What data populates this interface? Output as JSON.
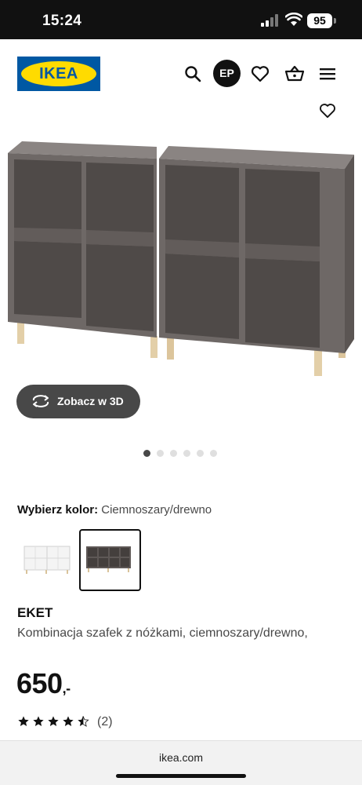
{
  "status_bar": {
    "time": "15:24",
    "battery": "95"
  },
  "header": {
    "logo_text": "IKEA",
    "account_initials": "EP"
  },
  "gallery": {
    "view_3d_label": "Zobacz w 3D",
    "dot_count": 6,
    "active_dot": 0
  },
  "color_selector": {
    "label": "Wybierz kolor:",
    "value": "Ciemnoszary/drewno",
    "options": [
      {
        "name": "Biały",
        "selected": false
      },
      {
        "name": "Ciemnoszary/drewno",
        "selected": true
      }
    ]
  },
  "product": {
    "name": "EKET",
    "description": "Kombinacja szafek z nóżkami, ciemnoszary/drewno,",
    "price": "650",
    "price_suffix": ",-",
    "rating": 4.5,
    "review_count": "(2)"
  },
  "browser": {
    "url": "ikea.com"
  },
  "colors": {
    "brand_blue": "#0058a3",
    "brand_yellow": "#ffdb00",
    "cabinet_grey": "#6e6866"
  }
}
